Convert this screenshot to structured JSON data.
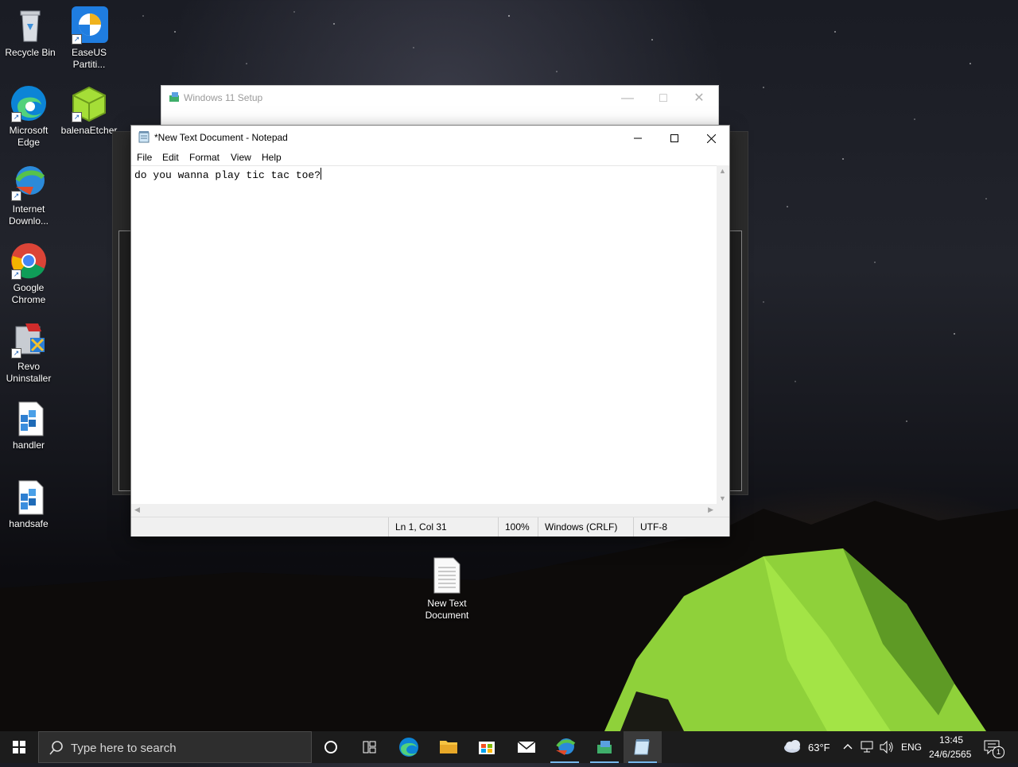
{
  "desktop": {
    "icons": [
      {
        "label_line1": "Recycle Bin",
        "label_line2": "",
        "icon": "recycle-bin-icon"
      },
      {
        "label_line1": "EaseUS",
        "label_line2": "Partiti...",
        "icon": "easeus-icon"
      },
      {
        "label_line1": "Microsoft",
        "label_line2": "Edge",
        "icon": "edge-icon"
      },
      {
        "label_line1": "balenaEtcher",
        "label_line2": "",
        "icon": "balena-etcher-icon"
      },
      {
        "label_line1": "Internet",
        "label_line2": "Downlo...",
        "icon": "internet-download-manager-icon"
      },
      {
        "label_line1": "Google",
        "label_line2": "Chrome",
        "icon": "chrome-icon"
      },
      {
        "label_line1": "Revo",
        "label_line2": "Uninstaller",
        "icon": "revo-uninstaller-icon"
      },
      {
        "label_line1": "handler",
        "label_line2": "",
        "icon": "registry-file-icon"
      },
      {
        "label_line1": "handsafe",
        "label_line2": "",
        "icon": "registry-file-icon"
      }
    ],
    "file": {
      "label_line1": "New Text",
      "label_line2": "Document"
    }
  },
  "setup_window": {
    "title": "Windows 11 Setup"
  },
  "notepad": {
    "title": "*New Text Document - Notepad",
    "menu": [
      "File",
      "Edit",
      "Format",
      "View",
      "Help"
    ],
    "content": "do you wanna play tic tac toe?",
    "status": {
      "position": "Ln 1, Col 31",
      "zoom": "100%",
      "line_ending": "Windows (CRLF)",
      "encoding": "UTF-8"
    }
  },
  "taskbar": {
    "search_placeholder": "Type here to search",
    "weather": "63°F",
    "language": "ENG",
    "time": "13:45",
    "date": "24/6/2565",
    "notification_count": "1"
  }
}
